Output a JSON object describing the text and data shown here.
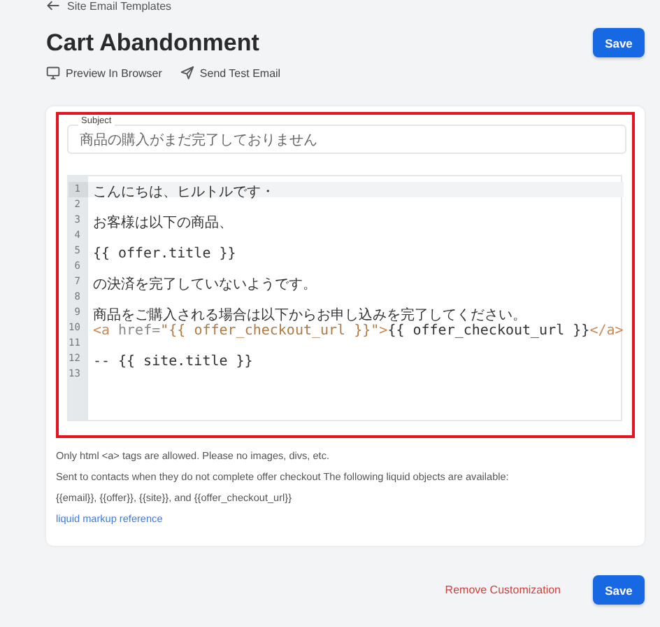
{
  "back_link": {
    "label": "Site Email Templates"
  },
  "title": "Cart Abandonment",
  "header_button": {
    "label": "Save"
  },
  "actions": [
    {
      "kind": "preview",
      "label": "Preview In Browser"
    },
    {
      "kind": "send",
      "label": "Send Test Email"
    }
  ],
  "subject": {
    "label": "Subject",
    "value": "商品の購入がまだ完了しておりません"
  },
  "editor": {
    "lines": [
      {
        "number": "1",
        "active": true,
        "segments": [
          {
            "kind": "text",
            "text": "こんにちは、ヒルトルです・"
          }
        ]
      },
      {
        "number": "2",
        "active": false
      },
      {
        "number": "3",
        "active": false,
        "segments": [
          {
            "kind": "text",
            "text": "お客様は以下の商品、"
          }
        ]
      },
      {
        "number": "4",
        "active": false
      },
      {
        "number": "5",
        "active": false,
        "segments": [
          {
            "kind": "text",
            "text": "{{ offer.title }}"
          }
        ]
      },
      {
        "number": "6",
        "active": false
      },
      {
        "number": "7",
        "active": false,
        "segments": [
          {
            "kind": "text",
            "text": "の決済を完了していないようです。"
          }
        ]
      },
      {
        "number": "8",
        "active": false
      },
      {
        "number": "9",
        "active": false,
        "segments": [
          {
            "kind": "text",
            "text": "商品をご購入される場合は以下からお申し込みを完了してください。"
          }
        ]
      },
      {
        "number": "10",
        "active": false,
        "segments": [
          {
            "kind": "tag",
            "text": "<a"
          },
          {
            "kind": "attr",
            "text": " href="
          },
          {
            "kind": "string",
            "text": "\"{{ offer_checkout_url }}\""
          },
          {
            "kind": "tag",
            "text": ">"
          },
          {
            "kind": "text",
            "text": "{{ offer_checkout_url }}"
          },
          {
            "kind": "tag",
            "text": "</a>"
          }
        ]
      },
      {
        "number": "11",
        "active": false
      },
      {
        "number": "12",
        "active": false,
        "segments": [
          {
            "kind": "text",
            "text": "-- {{ site.title }}"
          }
        ]
      },
      {
        "number": "13",
        "active": false
      }
    ]
  },
  "help_texts": [
    "Only html <a> tags are allowed. Please no images, divs, etc.",
    "Sent to contacts when they do not complete offer checkout The following liquid objects are available:",
    "{{email}}, {{offer}}, {{site}}, and {{offer_checkout_url}}"
  ],
  "reference_link": "liquid markup reference",
  "footer": {
    "remove_link": "Remove Customization",
    "save_button": "Save"
  }
}
